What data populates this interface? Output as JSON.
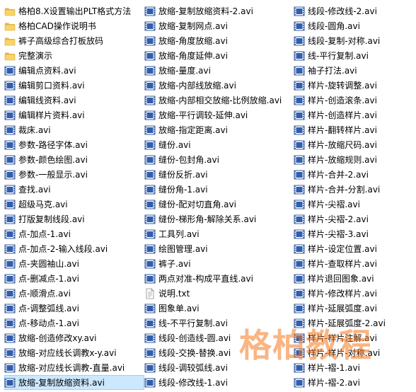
{
  "watermark_text": "格柏教程",
  "colors": {
    "selection": "#cce8ff",
    "folder": "#f3c94b",
    "video": "#1f4f9c",
    "watermark": "#f5781e"
  },
  "columns": [
    [
      {
        "name": "格柏8.X设置输出PLT格式方法",
        "icon": "folder"
      },
      {
        "name": "格柏CAD操作说明书",
        "icon": "folder"
      },
      {
        "name": "裤子高级综合打板放码",
        "icon": "folder"
      },
      {
        "name": "完整演示",
        "icon": "folder"
      },
      {
        "name": "编辑点资料.avi",
        "icon": "video"
      },
      {
        "name": "编辑剪口资料.avi",
        "icon": "video"
      },
      {
        "name": "编辑线资料.avi",
        "icon": "video"
      },
      {
        "name": "编辑样片资料.avi",
        "icon": "video"
      },
      {
        "name": "裁床.avi",
        "icon": "video"
      },
      {
        "name": "参数-路径字体.avi",
        "icon": "video"
      },
      {
        "name": "参数-颜色绘图.avi",
        "icon": "video"
      },
      {
        "name": "参数-一般显示.avi",
        "icon": "video"
      },
      {
        "name": "查找.avi",
        "icon": "video"
      },
      {
        "name": "超级马克.avi",
        "icon": "video"
      },
      {
        "name": "打版复制线段.avi",
        "icon": "video"
      },
      {
        "name": "点-加点-1.avi",
        "icon": "video"
      },
      {
        "name": "点-加点-2-输入线段.avi",
        "icon": "video"
      },
      {
        "name": "点-夹圆袖山.avi",
        "icon": "video"
      },
      {
        "name": "点-删减点-1.avi",
        "icon": "video"
      },
      {
        "name": "点-顺滑点.avi",
        "icon": "video"
      },
      {
        "name": "点-调整弧线.avi",
        "icon": "video"
      },
      {
        "name": "点-移动点-1.avi",
        "icon": "video"
      },
      {
        "name": "放缩-创造修改xy.avi",
        "icon": "video"
      },
      {
        "name": "放缩-对应线长调教x-y.avi",
        "icon": "video"
      },
      {
        "name": "放缩-对应线长调教-直量.avi",
        "icon": "video"
      },
      {
        "name": "放缩-复制放缩资料.avi",
        "icon": "video",
        "selected": true
      }
    ],
    [
      {
        "name": "放缩-复制放缩资料-2.avi",
        "icon": "video"
      },
      {
        "name": "放缩-复制网点.avi",
        "icon": "video"
      },
      {
        "name": "放缩-角度放缩.avi",
        "icon": "video"
      },
      {
        "name": "放缩-角度延伸.avi",
        "icon": "video"
      },
      {
        "name": "放缩-量度.avi",
        "icon": "video"
      },
      {
        "name": "放缩-内部线放缩.avi",
        "icon": "video"
      },
      {
        "name": "放缩-内部相交放缩-比例放缩.avi",
        "icon": "video"
      },
      {
        "name": "放缩-平行调较-延伸.avi",
        "icon": "video"
      },
      {
        "name": "放缩-指定距离.avi",
        "icon": "video"
      },
      {
        "name": "缝份.avi",
        "icon": "video"
      },
      {
        "name": "缝份-包封角.avi",
        "icon": "video"
      },
      {
        "name": "缝份反折.avi",
        "icon": "video"
      },
      {
        "name": "缝份角-1.avi",
        "icon": "video"
      },
      {
        "name": "缝份-配对切直角.avi",
        "icon": "video"
      },
      {
        "name": "缝份-梯形角-解除关系.avi",
        "icon": "video"
      },
      {
        "name": "工具列.avi",
        "icon": "video"
      },
      {
        "name": "绘图管理.avi",
        "icon": "video"
      },
      {
        "name": "裤子.avi",
        "icon": "video"
      },
      {
        "name": "两点对准-构成平直线.avi",
        "icon": "video"
      },
      {
        "name": "说明.txt",
        "icon": "text"
      },
      {
        "name": "图象单.avi",
        "icon": "video"
      },
      {
        "name": "线-不平行复制.avi",
        "icon": "video"
      },
      {
        "name": "线段-创造线-圆.avi",
        "icon": "video"
      },
      {
        "name": "线段-交换-替换.avi",
        "icon": "video"
      },
      {
        "name": "线段-调较弧线.avi",
        "icon": "video"
      },
      {
        "name": "线段-修改线-1.avi",
        "icon": "video"
      }
    ],
    [
      {
        "name": "线段-修改线-2.avi",
        "icon": "video"
      },
      {
        "name": "线段-圆角.avi",
        "icon": "video"
      },
      {
        "name": "线段-复制-对称.avi",
        "icon": "video"
      },
      {
        "name": "线-平行复制.avi",
        "icon": "video"
      },
      {
        "name": "袖子打法.avi",
        "icon": "video"
      },
      {
        "name": "样片-旋转调整.avi",
        "icon": "video"
      },
      {
        "name": "样片-创造滚条.avi",
        "icon": "video"
      },
      {
        "name": "样片-创造样片.avi",
        "icon": "video"
      },
      {
        "name": "样片-翻转样片.avi",
        "icon": "video"
      },
      {
        "name": "样片-放缩尺码.avi",
        "icon": "video"
      },
      {
        "name": "样片-放缩规则.avi",
        "icon": "video"
      },
      {
        "name": "样片-合并-2.avi",
        "icon": "video"
      },
      {
        "name": "样片-合并-分割.avi",
        "icon": "video"
      },
      {
        "name": "样片-尖褶.avi",
        "icon": "video"
      },
      {
        "name": "样片-尖褶-2.avi",
        "icon": "video"
      },
      {
        "name": "样片-尖褶-3.avi",
        "icon": "video"
      },
      {
        "name": "样片-设定位置.avi",
        "icon": "video"
      },
      {
        "name": "样片-查取样片.avi",
        "icon": "video"
      },
      {
        "name": "样片退回图象.avi",
        "icon": "video"
      },
      {
        "name": "样片-修改样片.avi",
        "icon": "video"
      },
      {
        "name": "样片-延展弧度.avi",
        "icon": "video"
      },
      {
        "name": "样片-延展弧度-2.avi",
        "icon": "video"
      },
      {
        "name": "样片-样片注解.avi",
        "icon": "video"
      },
      {
        "name": "样片-样片-对称.avi",
        "icon": "video"
      },
      {
        "name": "样片-褶-1.avi",
        "icon": "video"
      },
      {
        "name": "样片-褶-2.avi",
        "icon": "video"
      }
    ]
  ]
}
